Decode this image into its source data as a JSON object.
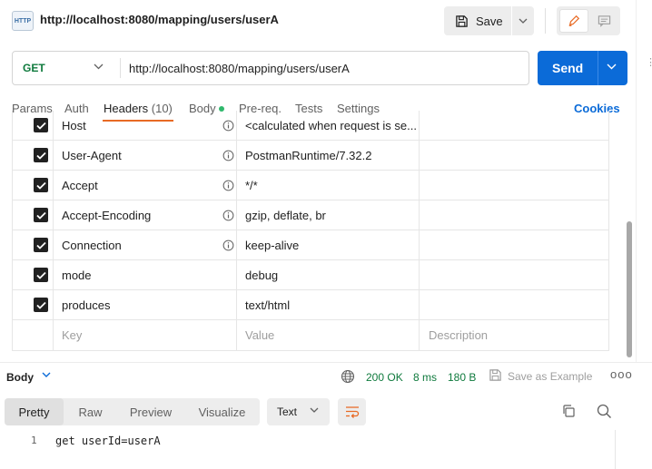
{
  "request": {
    "badge": "HTTP",
    "title": "http://localhost:8080/mapping/users/userA",
    "save_label": "Save",
    "method": "GET",
    "url": "http://localhost:8080/mapping/users/userA",
    "send_label": "Send"
  },
  "tabs": {
    "params": "Params",
    "auth": "Auth",
    "headers": "Headers",
    "headers_count": "(10)",
    "body": "Body",
    "prereq": "Pre-req.",
    "tests": "Tests",
    "settings": "Settings",
    "cookies": "Cookies"
  },
  "headers": {
    "rows": [
      {
        "key": "Host",
        "value": "<calculated when request is se...",
        "info": true,
        "checked": true
      },
      {
        "key": "User-Agent",
        "value": "PostmanRuntime/7.32.2",
        "info": true,
        "checked": true
      },
      {
        "key": "Accept",
        "value": "*/*",
        "info": true,
        "checked": true
      },
      {
        "key": "Accept-Encoding",
        "value": "gzip, deflate, br",
        "info": true,
        "checked": true
      },
      {
        "key": "Connection",
        "value": "keep-alive",
        "info": true,
        "checked": true
      },
      {
        "key": "mode",
        "value": "debug",
        "info": false,
        "checked": true
      },
      {
        "key": "produces",
        "value": "text/html",
        "info": false,
        "checked": true
      }
    ],
    "placeholder_key": "Key",
    "placeholder_value": "Value",
    "placeholder_desc": "Description"
  },
  "response": {
    "body_label": "Body",
    "status": "200 OK",
    "time": "8 ms",
    "size": "180 B",
    "save_example": "Save as Example",
    "more": "ooo",
    "view_tabs": [
      "Pretty",
      "Raw",
      "Preview",
      "Visualize"
    ],
    "active_view": "Pretty",
    "format": "Text",
    "line_number": "1",
    "code": "get userId=userA"
  },
  "colors": {
    "accent": "#e86a24",
    "send": "#0b6bd8",
    "method_get": "#0f7a3d",
    "status_ok": "#0f7a3d"
  }
}
